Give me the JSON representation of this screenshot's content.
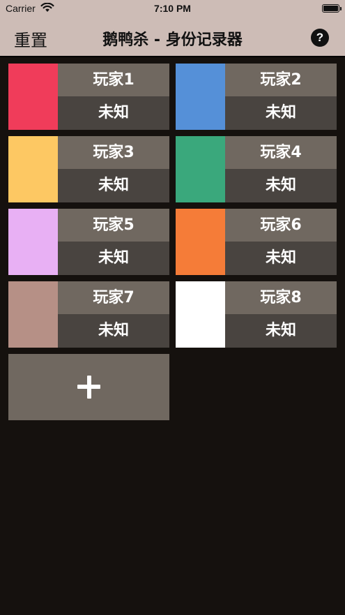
{
  "status_bar": {
    "carrier": "Carrier",
    "time": "7:10 PM"
  },
  "nav": {
    "reset_label": "重置",
    "title": "鹅鸭杀 - 身份记录器",
    "help_label": "?"
  },
  "players": [
    {
      "name": "玩家1",
      "role": "未知",
      "color": "#f03c5a"
    },
    {
      "name": "玩家2",
      "role": "未知",
      "color": "#5590d8"
    },
    {
      "name": "玩家3",
      "role": "未知",
      "color": "#fdc863"
    },
    {
      "name": "玩家4",
      "role": "未知",
      "color": "#3aa87c"
    },
    {
      "name": "玩家5",
      "role": "未知",
      "color": "#e8b0f4"
    },
    {
      "name": "玩家6",
      "role": "未知",
      "color": "#f57c38"
    },
    {
      "name": "玩家7",
      "role": "未知",
      "color": "#b69086"
    },
    {
      "name": "玩家8",
      "role": "未知",
      "color": "#ffffff"
    }
  ],
  "add_button": {
    "icon": "plus-icon"
  },
  "colors": {
    "nav_background": "#cdbcb6",
    "page_background": "#15110e",
    "name_cell": "#706860",
    "role_cell": "#494440"
  }
}
